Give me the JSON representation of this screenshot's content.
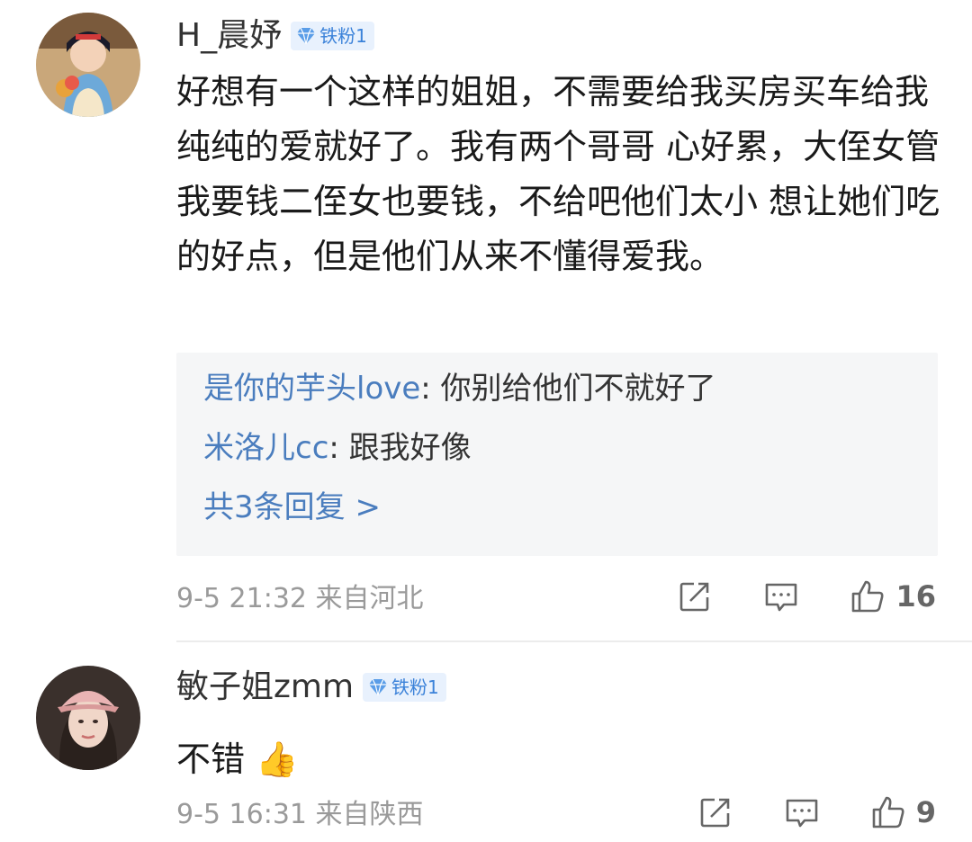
{
  "comments": [
    {
      "username": "H_晨妤",
      "badge": "铁粉1",
      "content": "好想有一个这样的姐姐，不需要给我买房买车给我纯纯的爱就好了。我有两个哥哥 心好累，大侄女管我要钱二侄女也要钱，不给吧他们太小 想让她们吃的好点，但是他们从来不懂得爱我。",
      "replies": [
        {
          "author": "是你的芋头love",
          "text": ": 你别给他们不就好了"
        },
        {
          "author": "米洛儿cc",
          "text": ": 跟我好像"
        }
      ],
      "more_replies": "共3条回复 >",
      "time": "9-5 21:32",
      "location": "来自河北",
      "likes": "16"
    },
    {
      "username": "敏子姐zmm",
      "badge": "铁粉1",
      "content": "不错",
      "emoji": "👍",
      "time": "9-5 16:31",
      "location": "来自陕西",
      "likes": "9"
    }
  ],
  "icons": [
    "avatar",
    "diamond-icon",
    "share-icon",
    "comment-icon",
    "like-icon"
  ],
  "colors": {
    "link": "#4a7dbe",
    "badge_bg": "#e8f1fd",
    "badge_text": "#3b82d9",
    "meta": "#9a9a9a",
    "reply_bg": "#f5f6f7"
  }
}
